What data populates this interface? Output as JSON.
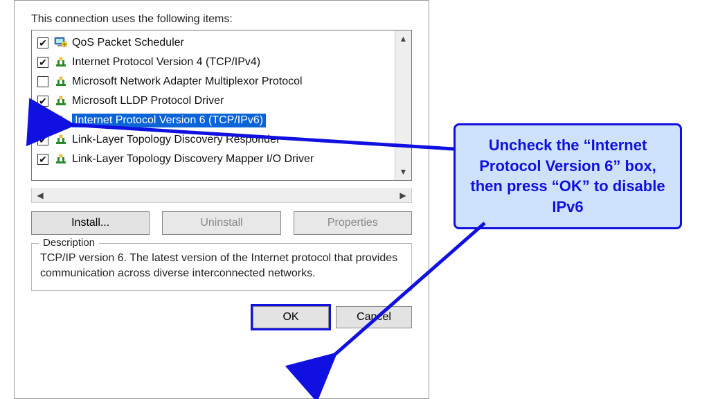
{
  "intro": "This connection uses the following items:",
  "items": [
    {
      "checked": true,
      "icon": "mon",
      "label": "QoS Packet Scheduler"
    },
    {
      "checked": true,
      "icon": "net",
      "label": "Internet Protocol Version 4 (TCP/IPv4)"
    },
    {
      "checked": false,
      "icon": "net",
      "label": "Microsoft Network Adapter Multiplexor Protocol"
    },
    {
      "checked": true,
      "icon": "net",
      "label": "Microsoft LLDP Protocol Driver"
    },
    {
      "checked": false,
      "icon": "net",
      "label": "Internet Protocol Version 6 (TCP/IPv6)",
      "selected": true,
      "ipv6": true
    },
    {
      "checked": true,
      "icon": "net",
      "label": "Link-Layer Topology Discovery Responder"
    },
    {
      "checked": true,
      "icon": "net",
      "label": "Link-Layer Topology Discovery Mapper I/O Driver"
    }
  ],
  "buttons": {
    "install": "Install...",
    "uninstall": "Uninstall",
    "properties": "Properties"
  },
  "description": {
    "title": "Description",
    "text": "TCP/IP version 6. The latest version of the Internet protocol that provides communication across diverse interconnected networks."
  },
  "footer": {
    "ok": "OK",
    "cancel": "Cancel"
  },
  "callout": "Uncheck the “Internet Protocol Version 6” box, then press “OK” to disable IPv6",
  "colors": {
    "highlight": "#1010e0",
    "selectBg": "#0a64d8",
    "calloutBg": "#cfe2fb"
  }
}
